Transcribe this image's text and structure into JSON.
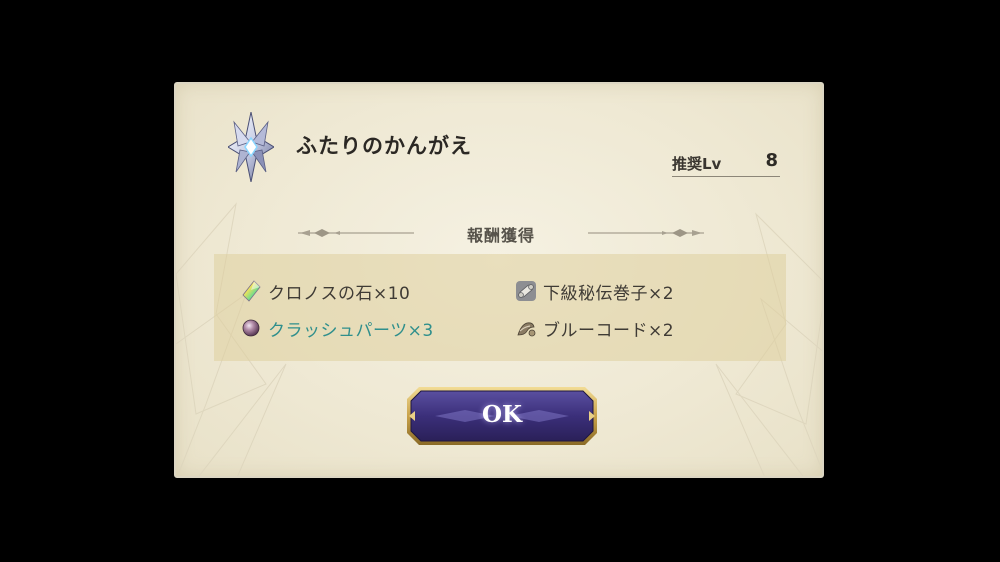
{
  "dialog": {
    "title": "ふたりのかんがえ",
    "recommended_level": {
      "label": "推奨Lv",
      "value": "8"
    },
    "section_title": "報酬獲得",
    "rewards": [
      {
        "text": "クロノスの石×10",
        "icon": "chronos-stone-icon",
        "highlight": false
      },
      {
        "text": "下級秘伝巻子×2",
        "icon": "scroll-icon",
        "highlight": false
      },
      {
        "text": "クラッシュパーツ×3",
        "icon": "crash-parts-orb-icon",
        "highlight": true
      },
      {
        "text": "ブルーコード×2",
        "icon": "blue-code-icon",
        "highlight": false
      }
    ],
    "ok_button": {
      "label": "OK"
    }
  },
  "colors": {
    "panel_bg": "#efe9d4",
    "highlight_text": "#2f8f8c",
    "button_purple": "#3b2f7a",
    "button_gold": "#c9a24a"
  }
}
